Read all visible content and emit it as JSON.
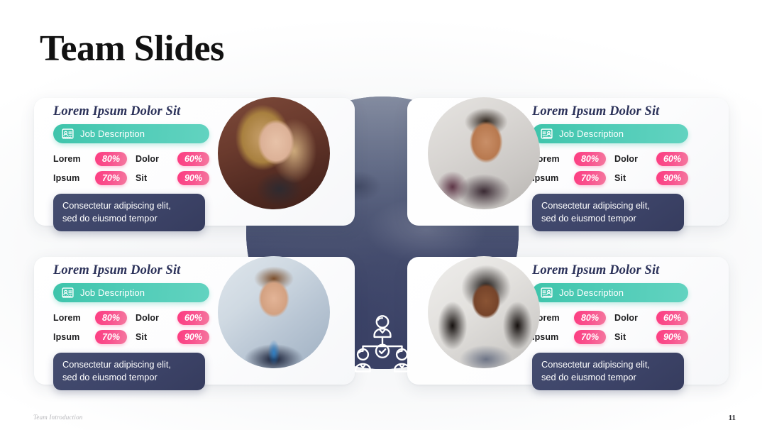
{
  "slide": {
    "title": "Team Slides",
    "footer_note": "Team Introduction",
    "page_number": "11"
  },
  "colors": {
    "title_text": "#111111",
    "name_text": "#2b3159",
    "teal_pill_start": "#3ec4ab",
    "teal_pill_end": "#62d3c0",
    "pink_pill_start": "#fc3d81",
    "pink_pill_end": "#f4799f",
    "quote_box": "#3e456a",
    "center_circle": "#3a4165",
    "card_background": "#ffffff",
    "slide_background": "#ffffff"
  },
  "center": {
    "icon": "team-org-chart-icon",
    "photo_alt": "meeting-desk-photo"
  },
  "portraits": [
    {
      "name": "portrait-top-left",
      "alt": "young-woman-blonde-brick-wall"
    },
    {
      "name": "portrait-top-right",
      "alt": "young-man-smiling-light-wall"
    },
    {
      "name": "portrait-bottom-left",
      "alt": "young-man-suit-blue-tie"
    },
    {
      "name": "portrait-bottom-right",
      "alt": "young-woman-braids-smiling"
    }
  ],
  "cards": [
    {
      "id": "card-top-left",
      "name": "Lorem Ipsum Dolor Sit",
      "job": {
        "icon": "id-badge-icon",
        "label": "Job Description"
      },
      "stats": [
        {
          "label": "Lorem",
          "value": "80%"
        },
        {
          "label": "Dolor",
          "value": "60%"
        },
        {
          "label": "Ipsum",
          "value": "70%"
        },
        {
          "label": "Sit",
          "value": "90%"
        }
      ],
      "quote_line1": "Consectetur adipiscing elit,",
      "quote_line2": "sed do eiusmod tempor"
    },
    {
      "id": "card-top-right",
      "name": "Lorem Ipsum Dolor Sit",
      "job": {
        "icon": "id-badge-icon",
        "label": "Job Description"
      },
      "stats": [
        {
          "label": "Lorem",
          "value": "80%"
        },
        {
          "label": "Dolor",
          "value": "60%"
        },
        {
          "label": "Ipsum",
          "value": "70%"
        },
        {
          "label": "Sit",
          "value": "90%"
        }
      ],
      "quote_line1": "Consectetur adipiscing elit,",
      "quote_line2": "sed do eiusmod tempor"
    },
    {
      "id": "card-bottom-left",
      "name": "Lorem Ipsum Dolor Sit",
      "job": {
        "icon": "id-badge-icon",
        "label": "Job Description"
      },
      "stats": [
        {
          "label": "Lorem",
          "value": "80%"
        },
        {
          "label": "Dolor",
          "value": "60%"
        },
        {
          "label": "Ipsum",
          "value": "70%"
        },
        {
          "label": "Sit",
          "value": "90%"
        }
      ],
      "quote_line1": "Consectetur adipiscing elit,",
      "quote_line2": "sed do eiusmod tempor"
    },
    {
      "id": "card-bottom-right",
      "name": "Lorem Ipsum Dolor Sit",
      "job": {
        "icon": "id-badge-icon",
        "label": "Job Description"
      },
      "stats": [
        {
          "label": "Lorem",
          "value": "80%"
        },
        {
          "label": "Dolor",
          "value": "60%"
        },
        {
          "label": "Ipsum",
          "value": "70%"
        },
        {
          "label": "Sit",
          "value": "90%"
        }
      ],
      "quote_line1": "Consectetur adipiscing elit,",
      "quote_line2": "sed do eiusmod tempor"
    }
  ]
}
